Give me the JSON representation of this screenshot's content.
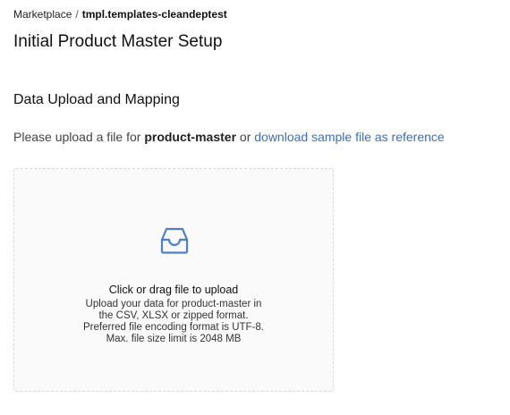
{
  "breadcrumb": {
    "root": "Marketplace",
    "separator": "/",
    "current": "tmpl.templates-cleandeptest"
  },
  "page": {
    "title": "Initial Product Master Setup"
  },
  "section": {
    "title": "Data Upload and Mapping"
  },
  "instruction": {
    "prefix": "Please upload a file for",
    "entity": "product-master",
    "connector": "or",
    "link_text": "download sample file as reference"
  },
  "dropzone": {
    "icon": "inbox-icon",
    "accent_color": "#3a6ec4",
    "title": "Click or drag file to upload",
    "hints": [
      "Upload your data for product-master in",
      "the CSV, XLSX or zipped format.",
      "Preferred file encoding format is UTF-8.",
      "Max. file size limit is 2048 MB"
    ]
  }
}
